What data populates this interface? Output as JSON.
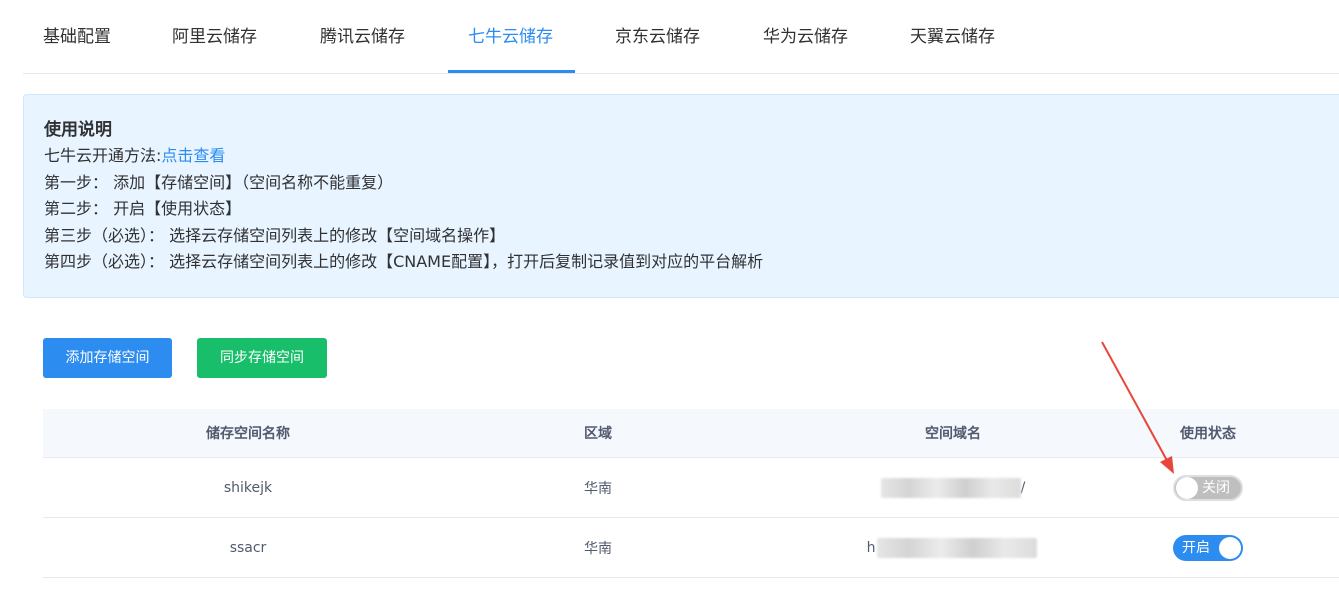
{
  "tabs": [
    {
      "label": "基础配置",
      "active": false
    },
    {
      "label": "阿里云储存",
      "active": false
    },
    {
      "label": "腾讯云储存",
      "active": false
    },
    {
      "label": "七牛云储存",
      "active": true
    },
    {
      "label": "京东云储存",
      "active": false
    },
    {
      "label": "华为云储存",
      "active": false
    },
    {
      "label": "天翼云储存",
      "active": false
    }
  ],
  "notice": {
    "title": "使用说明",
    "method_label": "七牛云开通方法:",
    "method_link": "点击查看",
    "steps": [
      "第一步： 添加【存储空间】（空间名称不能重复）",
      "第二步： 开启【使用状态】",
      "第三步（必选）： 选择云存储空间列表上的修改【空间域名操作】",
      "第四步（必选）： 选择云存储空间列表上的修改【CNAME配置】，打开后复制记录值到对应的平台解析"
    ]
  },
  "buttons": {
    "add": "添加存储空间",
    "sync": "同步存储空间"
  },
  "table": {
    "headers": [
      "储存空间名称",
      "区域",
      "空间域名",
      "使用状态"
    ],
    "rows": [
      {
        "name": "shikejk",
        "region": "华南",
        "domain_prefix": "",
        "domain_suffix": "/",
        "status": "关闭",
        "enabled": false
      },
      {
        "name": "ssacr",
        "region": "华南",
        "domain_prefix": "h",
        "domain_suffix": "",
        "status": "开启",
        "enabled": true
      }
    ]
  },
  "colors": {
    "accent": "#2d8cf0",
    "success": "#19be6b",
    "annotation_arrow": "#e8463a"
  }
}
